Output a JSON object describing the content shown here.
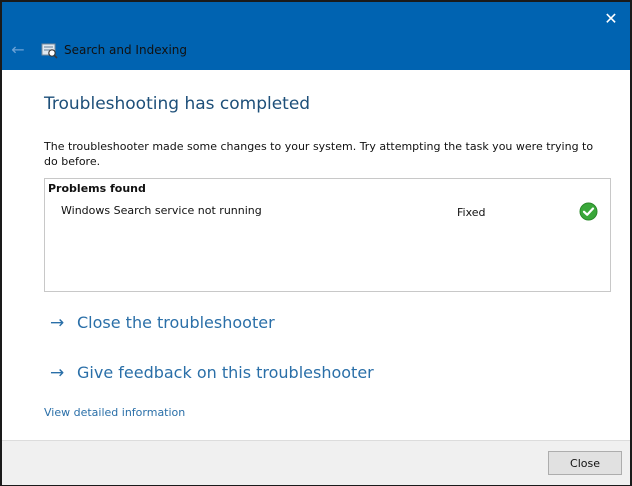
{
  "window": {
    "app_title": "Search and Indexing",
    "close_glyph": "✕",
    "back_glyph": "←"
  },
  "main": {
    "heading": "Troubleshooting has completed",
    "description": "The troubleshooter made some changes to your system. Try attempting the task you were trying to do before.",
    "problems": {
      "header": "Problems found",
      "items": [
        {
          "name": "Windows Search service not running",
          "status": "Fixed",
          "status_icon": "check-circle-icon"
        }
      ]
    },
    "links": [
      {
        "arrow": "→",
        "label": "Close the troubleshooter"
      },
      {
        "arrow": "→",
        "label": "Give feedback on this troubleshooter"
      }
    ],
    "detail_link": "View detailed information"
  },
  "footer": {
    "close_label": "Close"
  },
  "colors": {
    "titlebar": "#0063b1",
    "link": "#2a6fa8",
    "check": "#3aa73a"
  }
}
